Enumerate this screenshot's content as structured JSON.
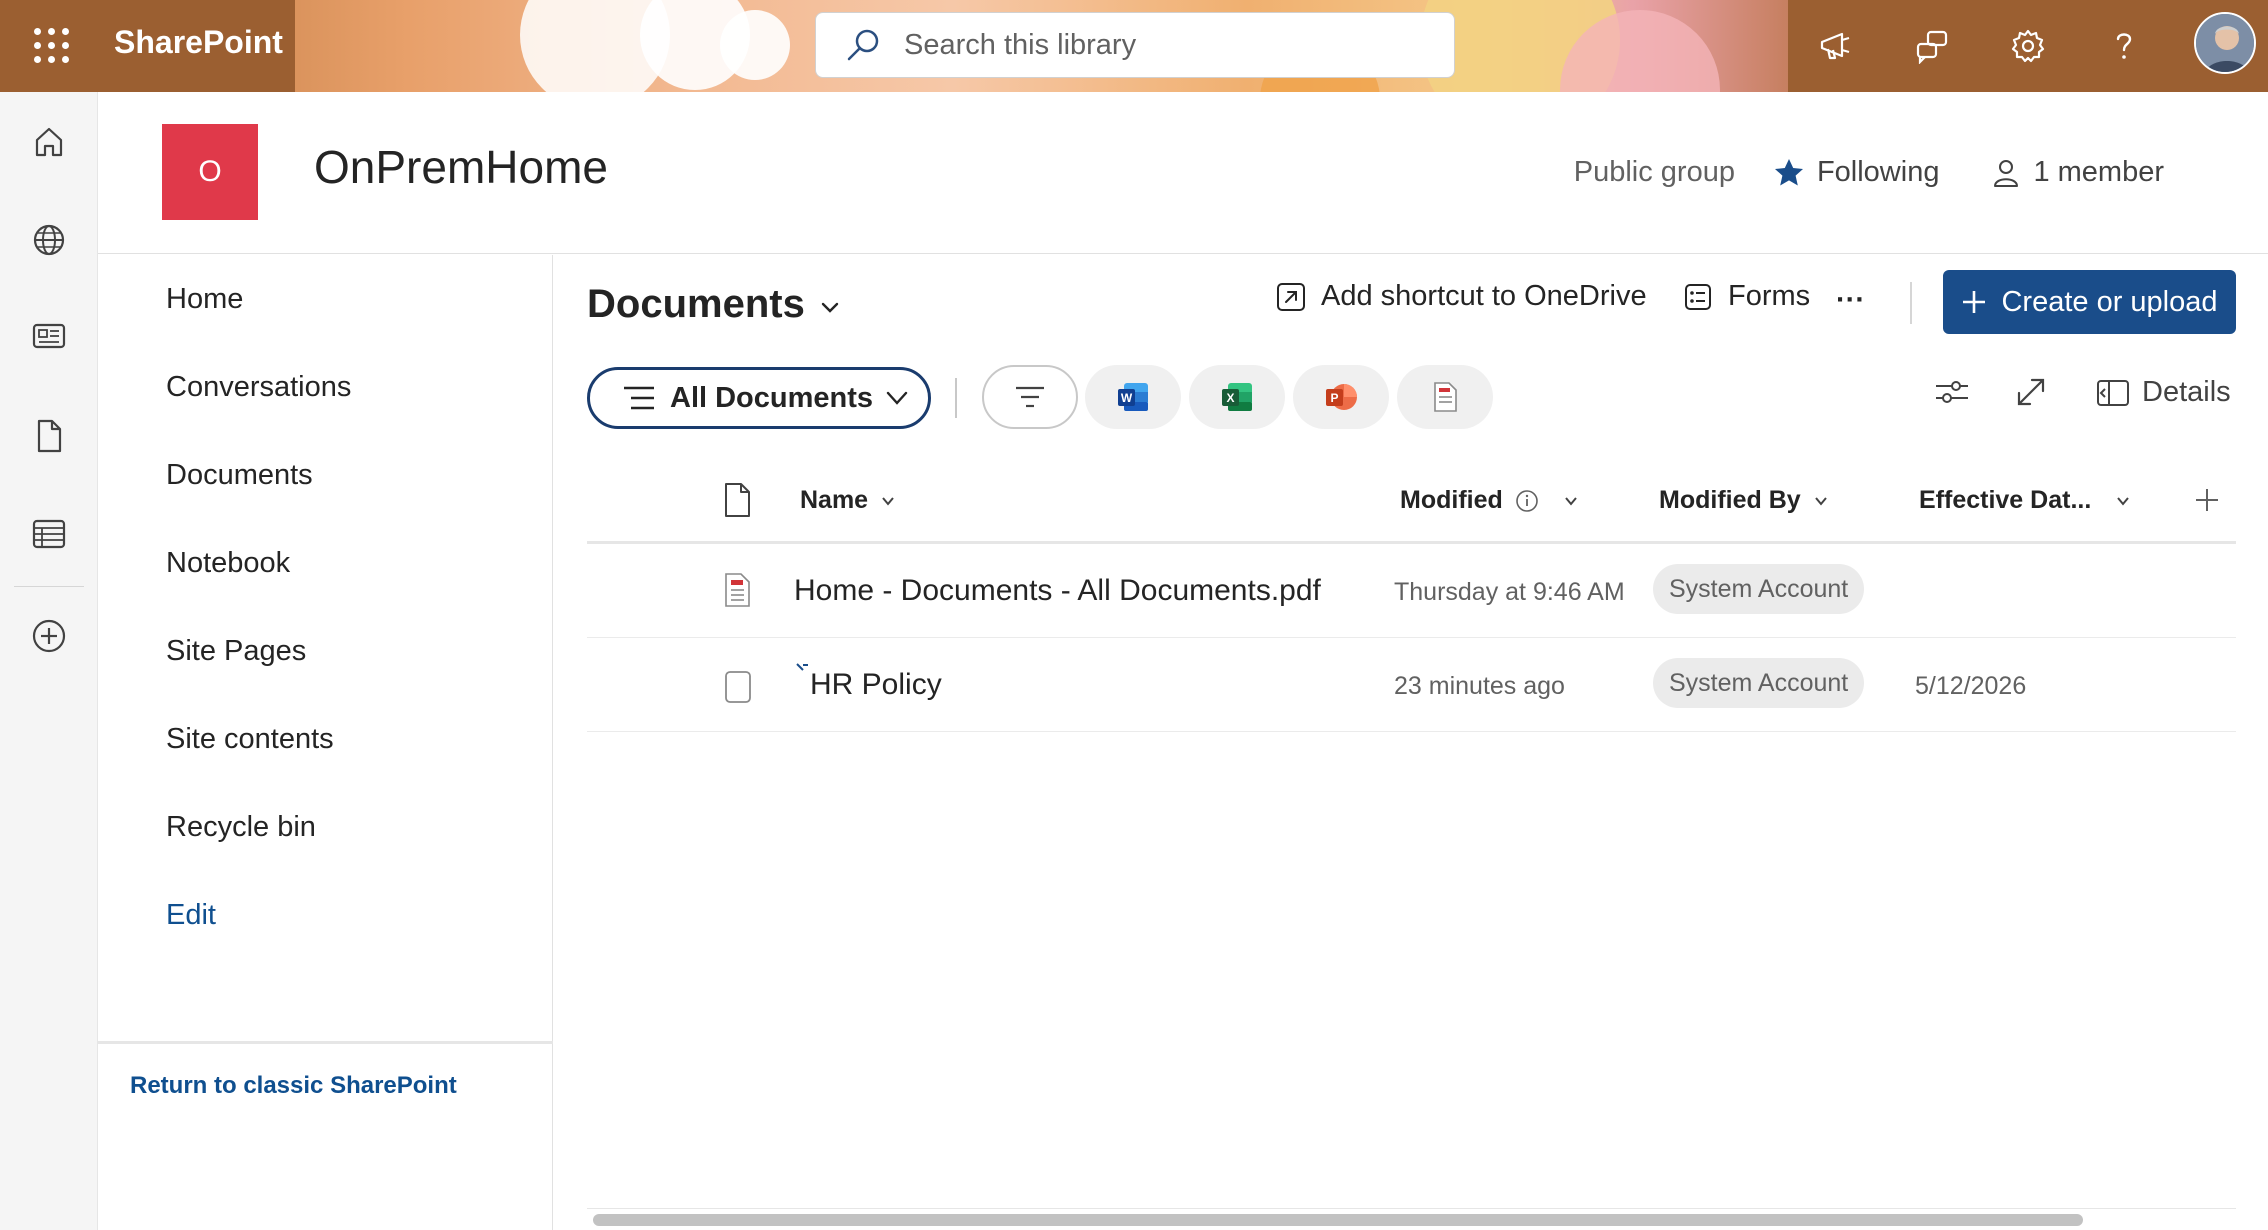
{
  "suite_bar": {
    "app_name": "SharePoint",
    "search_placeholder": "Search this library",
    "icons": [
      "app-launcher-icon",
      "megaphone-icon",
      "feedback-icon",
      "gear-icon",
      "help-icon",
      "avatar"
    ]
  },
  "site": {
    "logo_letter": "O",
    "title": "OnPremHome",
    "privacy": "Public group",
    "follow_label": "Following",
    "members_label": "1 member",
    "logo_color": "#e0394a"
  },
  "left_nav": {
    "items": [
      "Home",
      "Conversations",
      "Documents",
      "Notebook",
      "Site Pages",
      "Site contents",
      "Recycle bin"
    ],
    "edit_label": "Edit",
    "classic_link": "Return to classic SharePoint"
  },
  "command_bar": {
    "library_title": "Documents",
    "add_shortcut": "Add shortcut to OneDrive",
    "forms": "Forms",
    "more": "···",
    "create_upload": "Create or upload",
    "accent": "#1a4d8a"
  },
  "views": {
    "current_view": "All Documents",
    "details_label": "Details",
    "filter_chips": [
      "filter-icon",
      "word-icon",
      "excel-icon",
      "powerpoint-icon",
      "pdf-icon"
    ]
  },
  "list": {
    "columns": {
      "name": "Name",
      "modified": "Modified",
      "modified_by": "Modified By",
      "effective_date": "Effective Dat..."
    },
    "rows": [
      {
        "name": "Home - Documents - All Documents.pdf",
        "icon": "pdf-file-icon",
        "modified": "Thursday at 9:46 AM",
        "modified_by": "System Account",
        "effective_date": ""
      },
      {
        "name": "HR Policy",
        "icon": "blank-file-icon",
        "modified": "23 minutes ago",
        "modified_by": "System Account",
        "effective_date": "5/12/2026"
      }
    ]
  }
}
